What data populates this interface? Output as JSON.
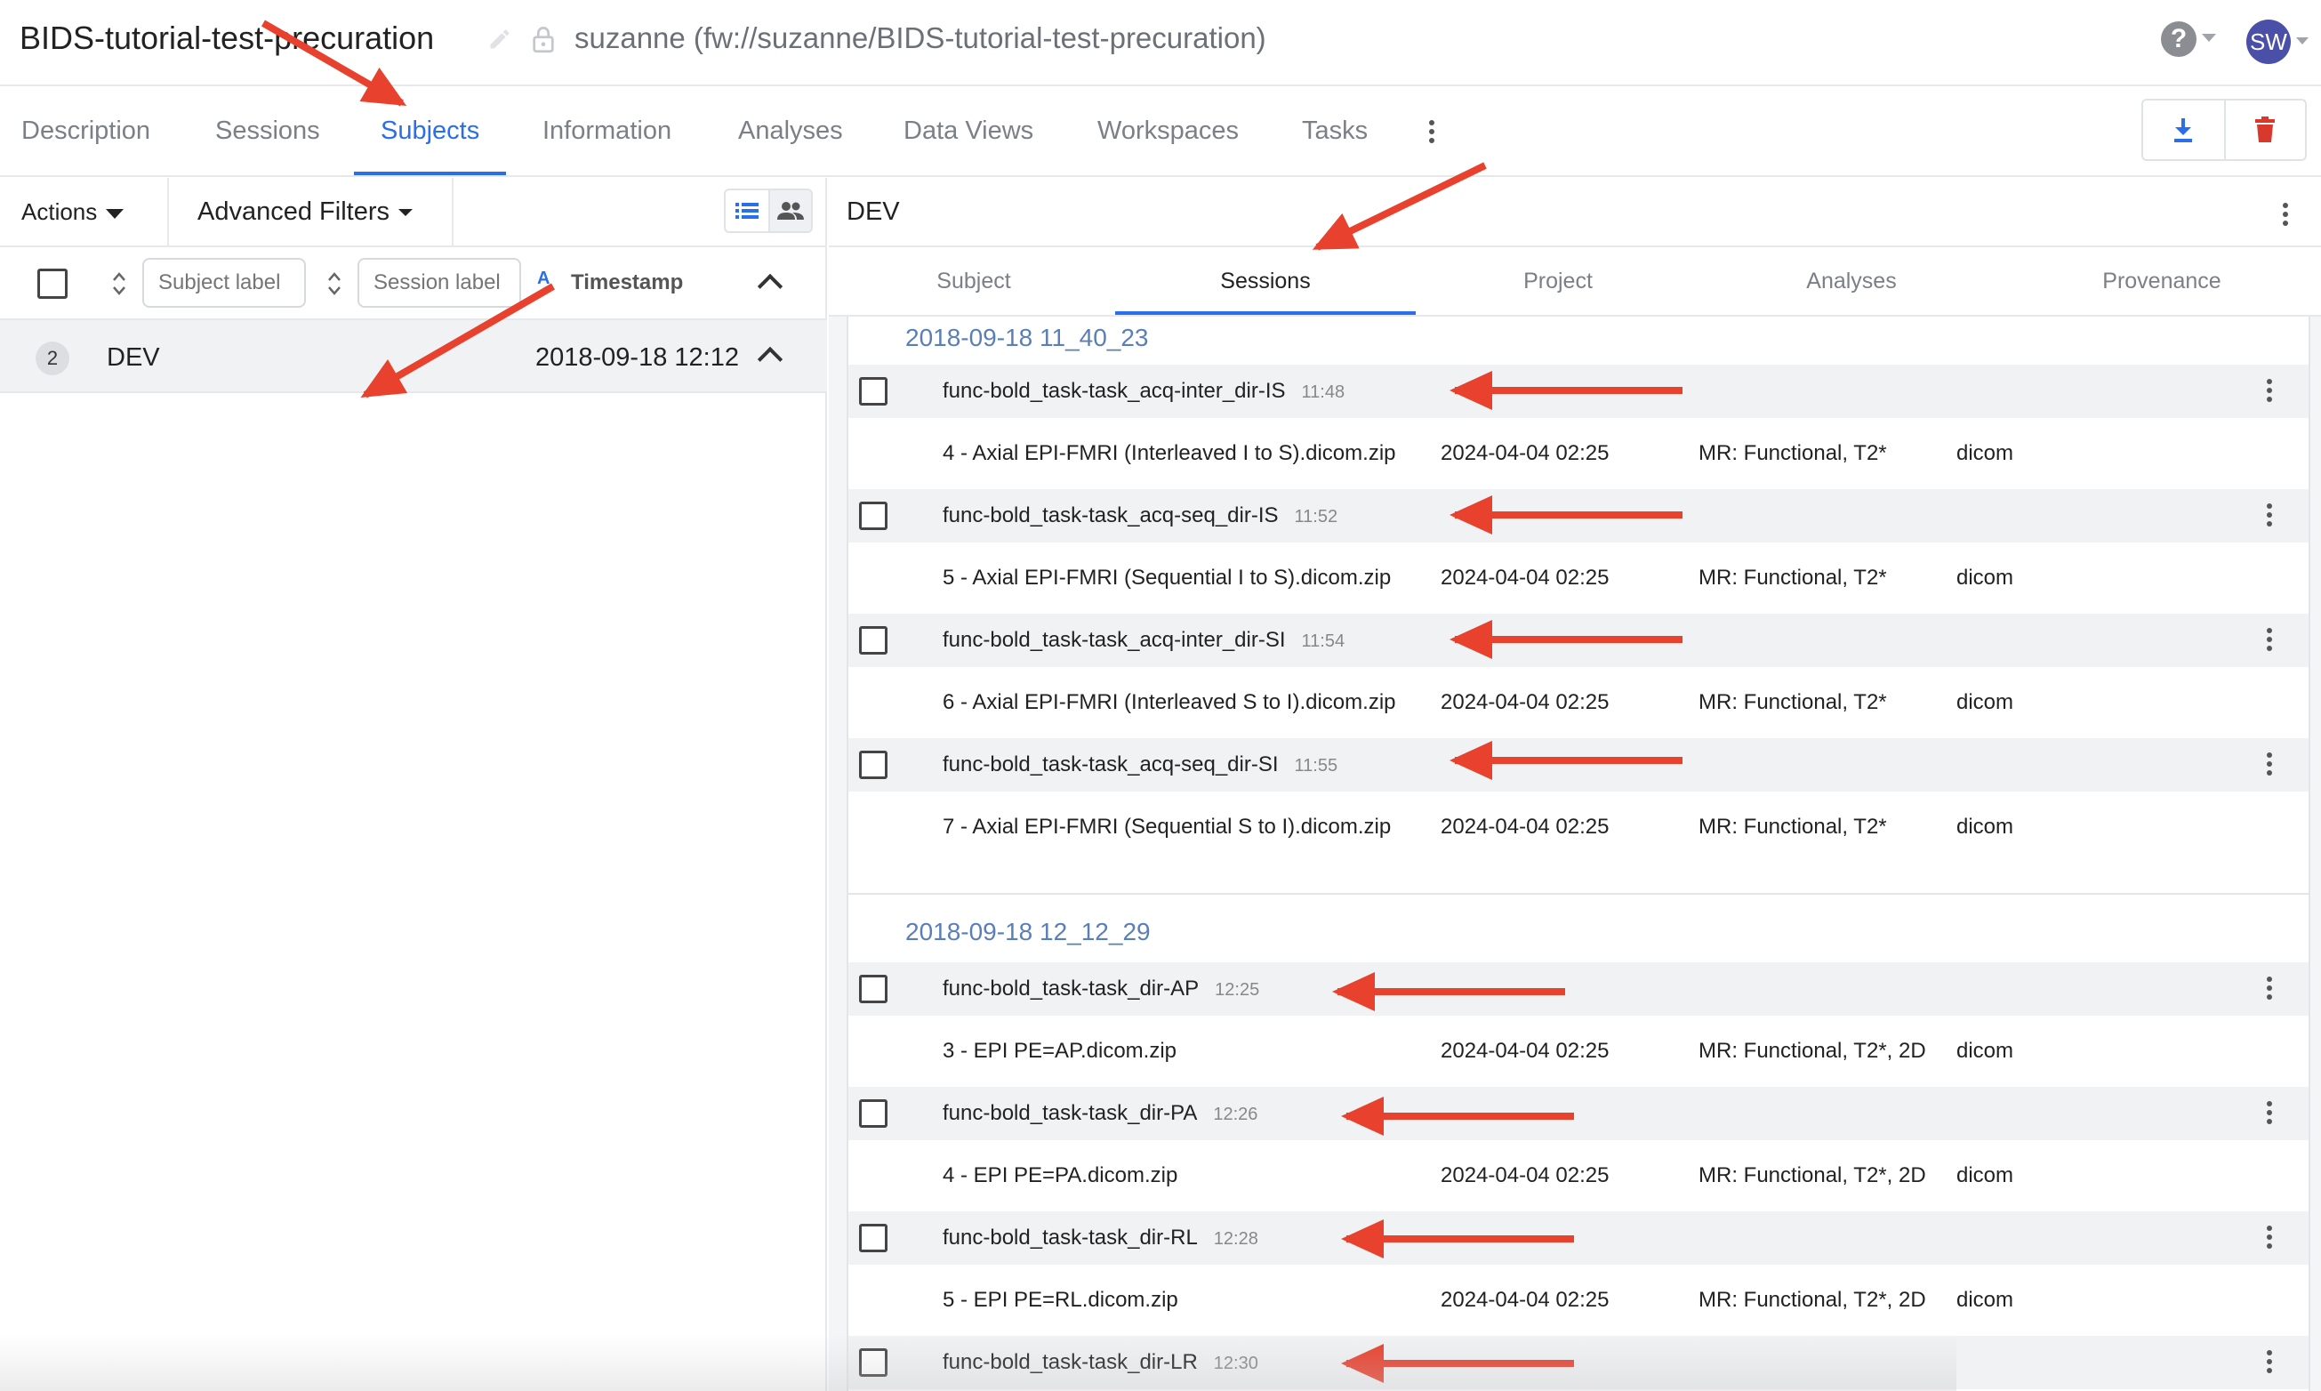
{
  "header": {
    "project_title": "BIDS-tutorial-test-precuration",
    "project_path": "suzanne (fw://suzanne/BIDS-tutorial-test-precuration)",
    "help_icon": "question-circle-icon",
    "help_glyph": "?",
    "avatar_initials": "SW"
  },
  "tabs": [
    {
      "label": "Description"
    },
    {
      "label": "Sessions"
    },
    {
      "label": "Subjects",
      "active": true
    },
    {
      "label": "Information"
    },
    {
      "label": "Analyses"
    },
    {
      "label": "Data Views"
    },
    {
      "label": "Workspaces"
    },
    {
      "label": "Tasks"
    }
  ],
  "left": {
    "actions_label": "Actions",
    "advanced_filters_label": "Advanced Filters",
    "subject_label_placeholder": "Subject label",
    "session_label_placeholder": "Session label",
    "az_glyph": "A",
    "timestamp_label": "Timestamp",
    "subject": {
      "count": "2",
      "label": "DEV",
      "timestamp": "2018-09-18 12:12"
    }
  },
  "right": {
    "title": "DEV",
    "subtabs": [
      {
        "label": "Subject"
      },
      {
        "label": "Sessions",
        "active": true
      },
      {
        "label": "Project"
      },
      {
        "label": "Analyses"
      },
      {
        "label": "Provenance"
      }
    ],
    "sessions": [
      {
        "date": "2018-09-18 11_40_23",
        "acquisitions": [
          {
            "label": "func-bold_task-task_acq-inter_dir-IS",
            "time": "11:48",
            "file": "4 - Axial EPI-FMRI (Interleaved I to S).dicom.zip",
            "file_date": "2024-04-04 02:25",
            "classification": "MR: Functional, T2*",
            "type": "dicom"
          },
          {
            "label": "func-bold_task-task_acq-seq_dir-IS",
            "time": "11:52",
            "file": "5 - Axial EPI-FMRI (Sequential I to S).dicom.zip",
            "file_date": "2024-04-04 02:25",
            "classification": "MR: Functional, T2*",
            "type": "dicom"
          },
          {
            "label": "func-bold_task-task_acq-inter_dir-SI",
            "time": "11:54",
            "file": "6 - Axial EPI-FMRI (Interleaved S to I).dicom.zip",
            "file_date": "2024-04-04 02:25",
            "classification": "MR: Functional, T2*",
            "type": "dicom"
          },
          {
            "label": "func-bold_task-task_acq-seq_dir-SI",
            "time": "11:55",
            "file": "7 - Axial EPI-FMRI (Sequential S to I).dicom.zip",
            "file_date": "2024-04-04 02:25",
            "classification": "MR: Functional, T2*",
            "type": "dicom"
          }
        ]
      },
      {
        "date": "2018-09-18 12_12_29",
        "acquisitions": [
          {
            "label": "func-bold_task-task_dir-AP",
            "time": "12:25",
            "file": "3 - EPI PE=AP.dicom.zip",
            "file_date": "2024-04-04 02:25",
            "classification": "MR: Functional, T2*, 2D",
            "type": "dicom"
          },
          {
            "label": "func-bold_task-task_dir-PA",
            "time": "12:26",
            "file": "4 - EPI PE=PA.dicom.zip",
            "file_date": "2024-04-04 02:25",
            "classification": "MR: Functional, T2*, 2D",
            "type": "dicom"
          },
          {
            "label": "func-bold_task-task_dir-RL",
            "time": "12:28",
            "file": "5 - EPI PE=RL.dicom.zip",
            "file_date": "2024-04-04 02:25",
            "classification": "MR: Functional, T2*, 2D",
            "type": "dicom"
          },
          {
            "label": "func-bold_task-task_dir-LR",
            "time": "12:30"
          }
        ]
      }
    ]
  },
  "colors": {
    "accent": "#2a6fe8",
    "danger": "#d9382c",
    "annotation_arrow": "#e8412e",
    "session_date": "#5a7fb8"
  }
}
